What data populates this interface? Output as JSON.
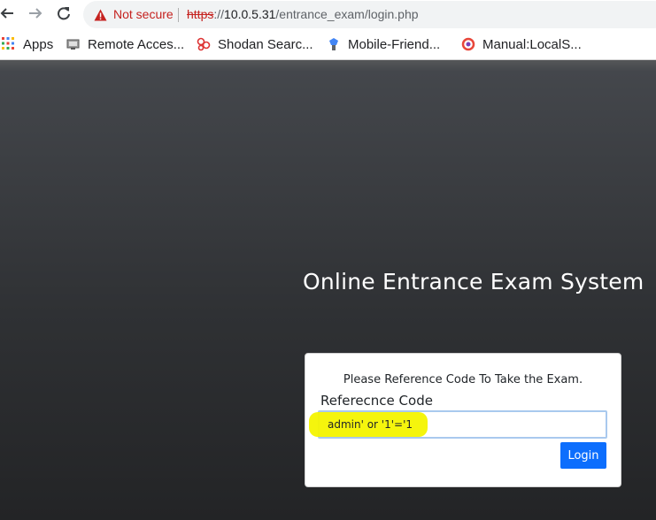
{
  "browser": {
    "security_label": "Not secure",
    "url_scheme": "https",
    "url_separator": "://",
    "url_host": "10.0.5.31",
    "url_path": "/entrance_exam/login.php"
  },
  "bookmarks": [
    {
      "label": "Apps",
      "icon": "apps-grid-icon"
    },
    {
      "label": "Remote Acces...",
      "icon": "remote-access-icon"
    },
    {
      "label": "Shodan Searc...",
      "icon": "shodan-icon"
    },
    {
      "label": "Mobile-Friend...",
      "icon": "mobile-friendly-icon"
    },
    {
      "label": "Manual:LocalS...",
      "icon": "mediawiki-icon"
    }
  ],
  "page": {
    "title": "Online Entrance Exam System",
    "card": {
      "message": "Please Reference Code To Take the Exam.",
      "field_label": "Referecnce Code",
      "input_value": "admin' or '1'='1",
      "button_label": "Login"
    }
  },
  "colors": {
    "page_background": "#2f3134",
    "button": "#0d6efd",
    "highlight": "#f4f400",
    "not_secure": "#c5221f"
  }
}
